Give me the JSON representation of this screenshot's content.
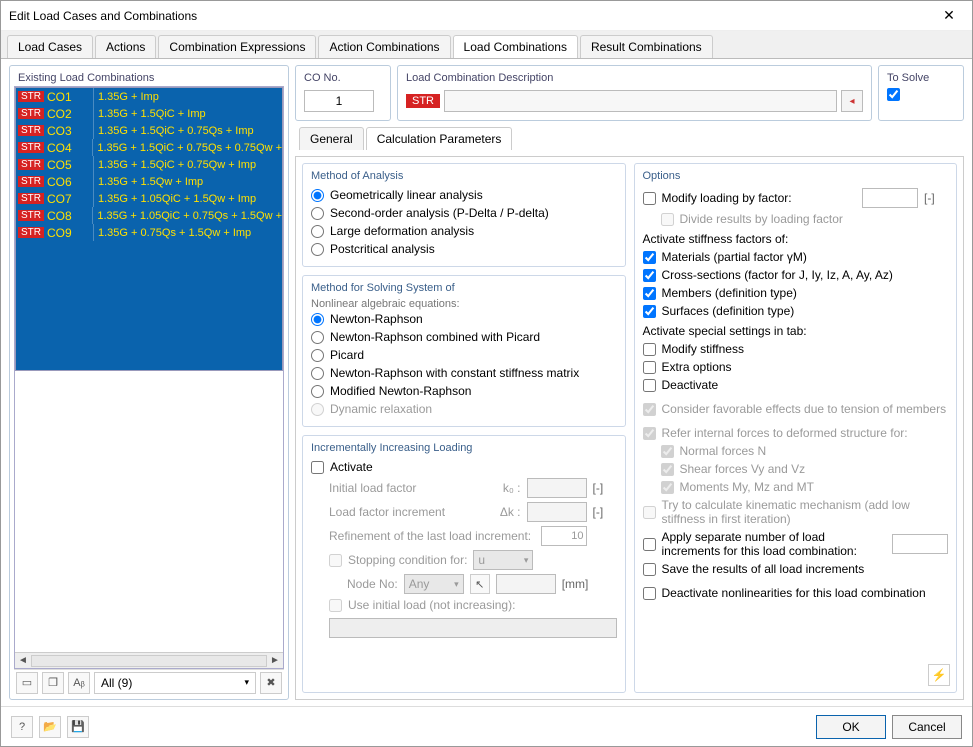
{
  "window": {
    "title": "Edit Load Cases and Combinations"
  },
  "mainTabs": {
    "items": [
      "Load Cases",
      "Actions",
      "Combination Expressions",
      "Action Combinations",
      "Load Combinations",
      "Result Combinations"
    ],
    "active": 4
  },
  "left": {
    "legend": "Existing Load Combinations",
    "rows": [
      {
        "badge": "STR",
        "code": "CO1",
        "formula": "1.35G + Imp"
      },
      {
        "badge": "STR",
        "code": "CO2",
        "formula": "1.35G + 1.5QiC + Imp"
      },
      {
        "badge": "STR",
        "code": "CO3",
        "formula": "1.35G + 1.5QiC + 0.75Qs + Imp"
      },
      {
        "badge": "STR",
        "code": "CO4",
        "formula": "1.35G + 1.5QiC + 0.75Qs + 0.75Qw +"
      },
      {
        "badge": "STR",
        "code": "CO5",
        "formula": "1.35G + 1.5QiC + 0.75Qw + Imp"
      },
      {
        "badge": "STR",
        "code": "CO6",
        "formula": "1.35G + 1.5Qw + Imp"
      },
      {
        "badge": "STR",
        "code": "CO7",
        "formula": "1.35G + 1.05QiC + 1.5Qw + Imp"
      },
      {
        "badge": "STR",
        "code": "CO8",
        "formula": "1.35G + 1.05QiC + 0.75Qs + 1.5Qw +"
      },
      {
        "badge": "STR",
        "code": "CO9",
        "formula": "1.35G + 0.75Qs + 1.5Qw + Imp"
      }
    ],
    "filter": "All (9)"
  },
  "top": {
    "coNoLabel": "CO No.",
    "coNoValue": "1",
    "descLabel": "Load Combination Description",
    "descBadge": "STR",
    "solveLabel": "To Solve"
  },
  "subTabs": {
    "items": [
      "General",
      "Calculation Parameters"
    ],
    "active": 1
  },
  "analysis": {
    "title": "Method of Analysis",
    "options": [
      "Geometrically linear analysis",
      "Second-order analysis (P-Delta / P-delta)",
      "Large deformation analysis",
      "Postcritical analysis"
    ],
    "selected": 0
  },
  "solving": {
    "title": "Method for Solving System of",
    "subtitle": "Nonlinear algebraic equations:",
    "options": [
      "Newton-Raphson",
      "Newton-Raphson combined with Picard",
      "Picard",
      "Newton-Raphson with constant stiffness matrix",
      "Modified Newton-Raphson",
      "Dynamic relaxation"
    ],
    "selected": 0,
    "disabled": [
      5
    ]
  },
  "incremental": {
    "title": "Incrementally Increasing Loading",
    "activate": "Activate",
    "initial": "Initial load factor",
    "initialSym": "k₀ :",
    "increment": "Load factor increment",
    "incrementSym": "Δk :",
    "refinement": "Refinement of the last load increment:",
    "refineVal": "10",
    "stopping": "Stopping condition for:",
    "stopVar": "u",
    "nodeNo": "Node No:",
    "nodeSel": "Any",
    "nodeUnit": "[mm]",
    "useInitial": "Use initial load (not increasing):"
  },
  "options": {
    "title": "Options",
    "modifyLoading": "Modify loading by factor:",
    "divide": "Divide results by loading factor",
    "activateStiff": "Activate stiffness factors of:",
    "materials": "Materials (partial factor γM)",
    "cross": "Cross-sections (factor for J, Iy, Iz, A, Ay, Az)",
    "members": "Members (definition type)",
    "surfaces": "Surfaces (definition type)",
    "activateSpecial": "Activate special settings in tab:",
    "modifyStiff": "Modify stiffness",
    "extra": "Extra options",
    "deactivate": "Deactivate",
    "consider": "Consider favorable effects due to tension of members",
    "refer": "Refer internal forces to deformed structure for:",
    "normal": "Normal forces N",
    "shear": "Shear forces Vy and Vz",
    "moments": "Moments My, Mz and MT",
    "kinematic": "Try to calculate kinematic mechanism (add low stiffness in first iteration)",
    "applySep": "Apply separate number of load increments for this load combination:",
    "saveRes": "Save the results of all load increments",
    "deactNonlin": "Deactivate nonlinearities for this load combination"
  },
  "footer": {
    "ok": "OK",
    "cancel": "Cancel"
  },
  "units": {
    "bracket": "[-]"
  }
}
